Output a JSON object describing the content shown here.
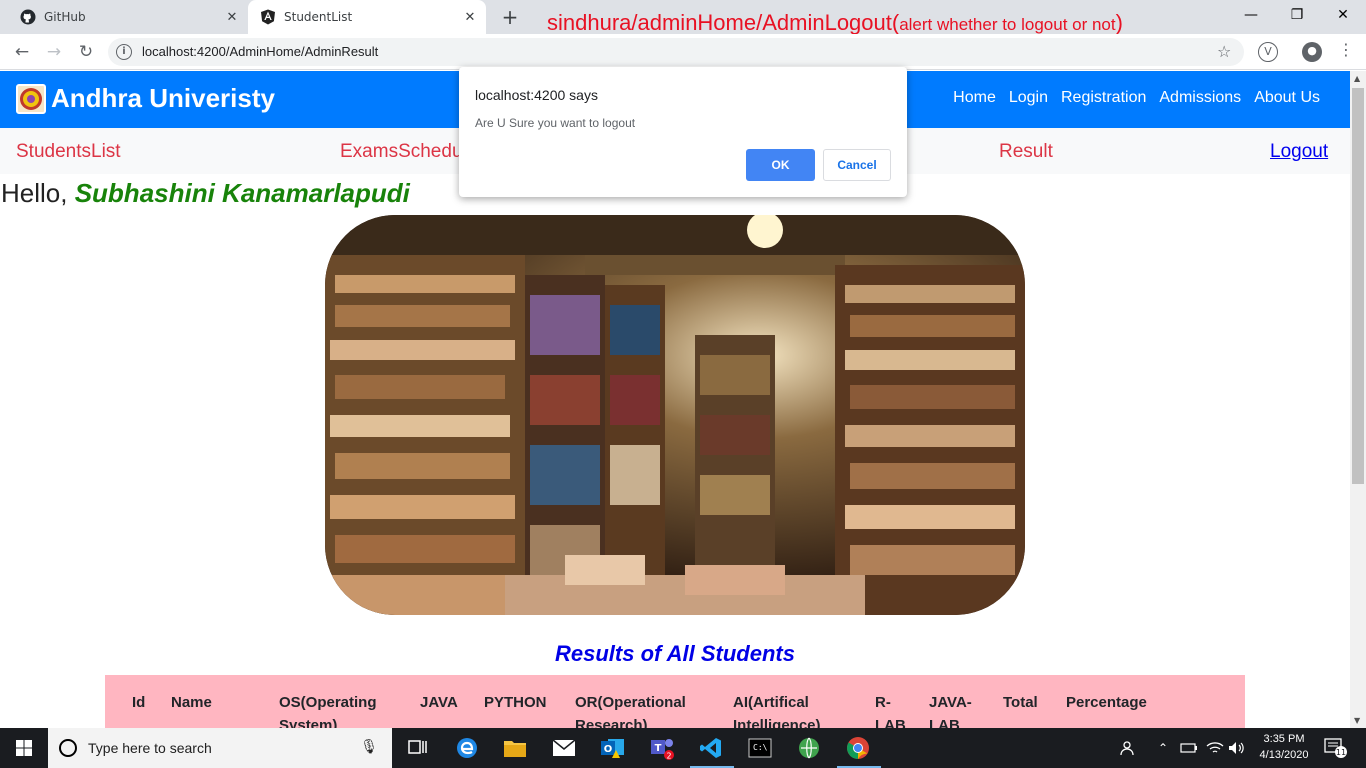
{
  "browser": {
    "tabs": [
      {
        "title": "GitHub",
        "icon": "github-icon",
        "active": false
      },
      {
        "title": "StudentList",
        "icon": "angular-icon",
        "active": true
      }
    ],
    "url": "localhost:4200/AdminHome/AdminResult",
    "annotation": {
      "main": "sindhura/adminHome/AdminLogout(",
      "small": "alert whether to logout or not",
      "close": ")"
    }
  },
  "navbar": {
    "brand": "Andhra Univeristy",
    "links": [
      "Home",
      "Login",
      "Registration",
      "Admissions",
      "About Us"
    ],
    "color": "#007bff"
  },
  "subnav": {
    "items": [
      "StudentsList",
      "ExamsSchedu",
      "Result"
    ],
    "logout": "Logout"
  },
  "greeting": {
    "prefix": "Hello, ",
    "name": "Subhashini Kanamarlapudi"
  },
  "results_title": "Results of All Students",
  "table": {
    "headers": [
      "Id",
      "Name",
      "OS(Operating System)",
      "JAVA",
      "PYTHON",
      "OR(Operational Research)",
      "AI(Artifical Intelligence)",
      "R-LAB",
      "JAVA-LAB",
      "Total",
      "Percentage"
    ],
    "header_bg": "#ffb6c1"
  },
  "dialog": {
    "title": "localhost:4200 says",
    "message": "Are U Sure you want to logout",
    "ok": "OK",
    "cancel": "Cancel"
  },
  "taskbar": {
    "search_placeholder": "Type here to search",
    "time": "3:35 PM",
    "date": "4/13/2020",
    "notifications": "11",
    "teams_badge": "2"
  }
}
